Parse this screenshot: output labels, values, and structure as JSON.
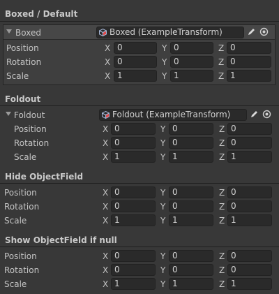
{
  "sections": {
    "boxed": {
      "title": "Boxed / Default",
      "foldout_label": "Boxed",
      "object_value": "Boxed (ExampleTransform)"
    },
    "foldout": {
      "title": "Foldout",
      "foldout_label": "Foldout",
      "object_value": "Foldout (ExampleTransform)"
    },
    "hide_object": {
      "title": "Hide ObjectField"
    },
    "show_if_null": {
      "title": "Show ObjectField if null"
    }
  },
  "labels": {
    "position": "Position",
    "rotation": "Rotation",
    "scale": "Scale"
  },
  "axes": {
    "x": "X",
    "y": "Y",
    "z": "Z"
  },
  "values": {
    "position": {
      "x": "0",
      "y": "0",
      "z": "0"
    },
    "rotation": {
      "x": "0",
      "y": "0",
      "z": "0"
    },
    "scale": {
      "x": "1",
      "y": "1",
      "z": "1"
    }
  },
  "icons": {
    "object_icon": "cube-icon",
    "edit_icon": "pencil-icon",
    "picker_icon": "object-picker-icon",
    "foldout_icon": "triangle-down-icon"
  }
}
